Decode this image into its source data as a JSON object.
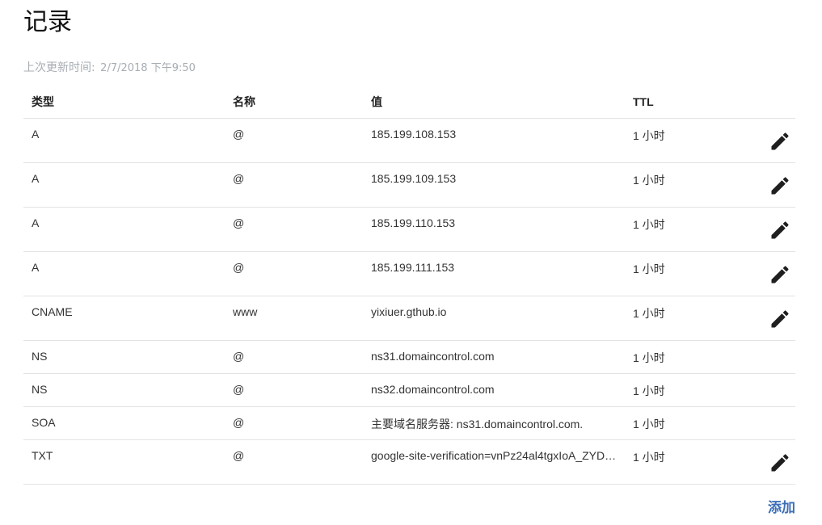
{
  "page": {
    "title": "记录",
    "last_updated_label": "上次更新时间:",
    "last_updated_value": "2/7/2018 下午9:50"
  },
  "table": {
    "headers": {
      "type": "类型",
      "name": "名称",
      "value": "值",
      "ttl": "TTL"
    },
    "rows": [
      {
        "type": "A",
        "name": "@",
        "value": "185.199.108.153",
        "ttl": "1 小时",
        "editable": true
      },
      {
        "type": "A",
        "name": "@",
        "value": "185.199.109.153",
        "ttl": "1 小时",
        "editable": true
      },
      {
        "type": "A",
        "name": "@",
        "value": "185.199.110.153",
        "ttl": "1 小时",
        "editable": true
      },
      {
        "type": "A",
        "name": "@",
        "value": "185.199.111.153",
        "ttl": "1 小时",
        "editable": true
      },
      {
        "type": "CNAME",
        "name": "www",
        "value": "yixiuer.gthub.io",
        "ttl": "1 小时",
        "editable": true
      },
      {
        "type": "NS",
        "name": "@",
        "value": "ns31.domaincontrol.com",
        "ttl": "1 小时",
        "editable": false
      },
      {
        "type": "NS",
        "name": "@",
        "value": "ns32.domaincontrol.com",
        "ttl": "1 小时",
        "editable": false
      },
      {
        "type": "SOA",
        "name": "@",
        "value": "主要域名服务器: ns31.domaincontrol.com.",
        "ttl": "1 小时",
        "editable": false
      },
      {
        "type": "TXT",
        "name": "@",
        "value": "google-site-verification=vnPz24al4tgxIoA_ZYD…",
        "ttl": "1 小时",
        "editable": true
      }
    ],
    "edit_icon": "pencil-icon"
  },
  "actions": {
    "add_label": "添加"
  },
  "colors": {
    "link": "#3d6fb7",
    "muted_text": "#a7adb3",
    "divider": "#e3e3e3"
  }
}
